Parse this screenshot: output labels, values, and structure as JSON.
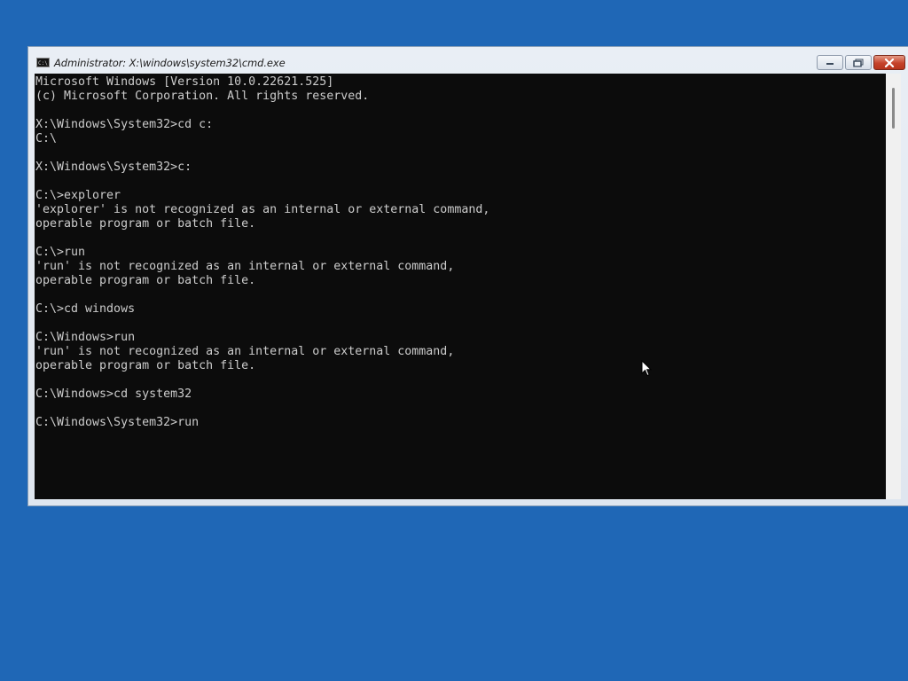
{
  "window": {
    "title": "Administrator: X:\\windows\\system32\\cmd.exe",
    "app_icon": "cmd-icon",
    "caption_buttons": [
      "minimize-icon",
      "maximize-icon",
      "close-icon"
    ]
  },
  "console": {
    "lines": [
      "Microsoft Windows [Version 10.0.22621.525]",
      "(c) Microsoft Corporation. All rights reserved.",
      "",
      "X:\\Windows\\System32>cd c:",
      "C:\\",
      "",
      "X:\\Windows\\System32>c:",
      "",
      "C:\\>explorer",
      "'explorer' is not recognized as an internal or external command,",
      "operable program or batch file.",
      "",
      "C:\\>run",
      "'run' is not recognized as an internal or external command,",
      "operable program or batch file.",
      "",
      "C:\\>cd windows",
      "",
      "C:\\Windows>run",
      "'run' is not recognized as an internal or external command,",
      "operable program or batch file.",
      "",
      "C:\\Windows>cd system32",
      "",
      "C:\\Windows\\System32>run"
    ]
  },
  "colors": {
    "desktop": "#1f67b6",
    "console_bg": "#0c0c0c",
    "console_fg": "#cccccc",
    "close_button": "#c5432a"
  }
}
